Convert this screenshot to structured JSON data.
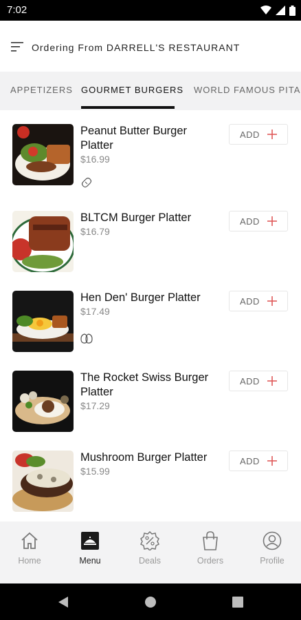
{
  "status_bar": {
    "time": "7:02",
    "icons": [
      "wifi-icon",
      "signal-icon",
      "battery-icon"
    ]
  },
  "header": {
    "title": "Ordering From DARRELL'S RESTAURANT",
    "menu_icon": "menu-icon"
  },
  "tabs": [
    {
      "label": "APPETIZERS",
      "active": false
    },
    {
      "label": "GOURMET BURGERS",
      "active": true
    },
    {
      "label": "WORLD FAMOUS PITAS",
      "active": false
    }
  ],
  "items": [
    {
      "name": "Peanut Butter Burger Platter",
      "price": "$16.99",
      "add_label": "ADD",
      "tag_icon": "peanut-icon"
    },
    {
      "name": "BLTCM Burger Platter",
      "price": "$16.79",
      "add_label": "ADD",
      "tag_icon": ""
    },
    {
      "name": "Hen Den' Burger Platter",
      "price": "$17.49",
      "add_label": "ADD",
      "tag_icon": "egg-icon"
    },
    {
      "name": "The Rocket Swiss Burger Platter",
      "price": "$17.29",
      "add_label": "ADD",
      "tag_icon": ""
    },
    {
      "name": "Mushroom Burger Platter",
      "price": "$15.99",
      "add_label": "ADD",
      "tag_icon": ""
    }
  ],
  "bottom_nav": [
    {
      "label": "Home",
      "icon": "home-icon",
      "active": false
    },
    {
      "label": "Menu",
      "icon": "menu-icon",
      "active": true
    },
    {
      "label": "Deals",
      "icon": "deals-icon",
      "active": false
    },
    {
      "label": "Orders",
      "icon": "orders-icon",
      "active": false
    },
    {
      "label": "Profile",
      "icon": "profile-icon",
      "active": false
    }
  ],
  "system_nav": [
    "back-icon",
    "home-circle-icon",
    "recents-icon"
  ],
  "colors": {
    "accent": "#e05a5a",
    "tab_bar": "#f2f2f3",
    "bottom_nav": "#f3f3f4"
  }
}
